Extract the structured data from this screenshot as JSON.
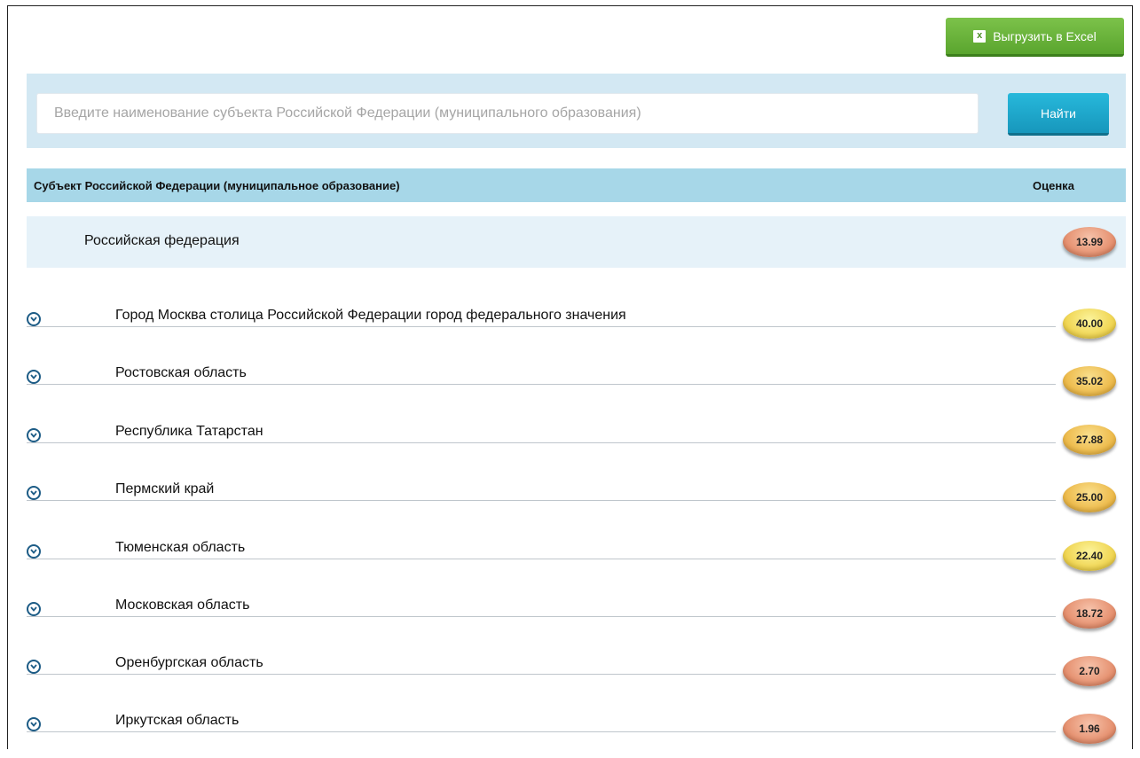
{
  "toolbar": {
    "excel_label": "Выгрузить в Excel",
    "excel_icon": "excel-icon"
  },
  "search": {
    "placeholder": "Введите наименование субъекта Российской Федерации (муниципального образования)",
    "value": "",
    "button_label": "Найти"
  },
  "table": {
    "col_name": "Субъект Российской Федерации (муниципальное образование)",
    "col_score": "Оценка",
    "federation": {
      "name": "Российская федерация",
      "score": "13.99"
    },
    "rows": [
      {
        "name": "Город Москва столица Российской Федерации город федерального значения",
        "score": "40.00"
      },
      {
        "name": "Ростовская область",
        "score": "35.02"
      },
      {
        "name": "Республика Татарстан",
        "score": "27.88"
      },
      {
        "name": "Пермский край",
        "score": "25.00"
      },
      {
        "name": "Тюменская область",
        "score": "22.40"
      },
      {
        "name": "Московская область",
        "score": "18.72"
      },
      {
        "name": "Оренбургская область",
        "score": "2.70"
      },
      {
        "name": "Иркутская область",
        "score": "1.96"
      }
    ]
  },
  "colors": {
    "excel_button": "#5aa52e",
    "find_button": "#1797bc",
    "search_band": "#d3e8f3",
    "header_band": "#a7d7e8",
    "federation_row": "#e6f2f9",
    "badge_red": "#e48c6a",
    "badge_yellow": "#efd24b",
    "badge_gold": "#ecb745"
  },
  "badge_styles": [
    "red",
    "yellow",
    "gold",
    "gold",
    "gold",
    "yellow",
    "red",
    "red",
    "red"
  ]
}
